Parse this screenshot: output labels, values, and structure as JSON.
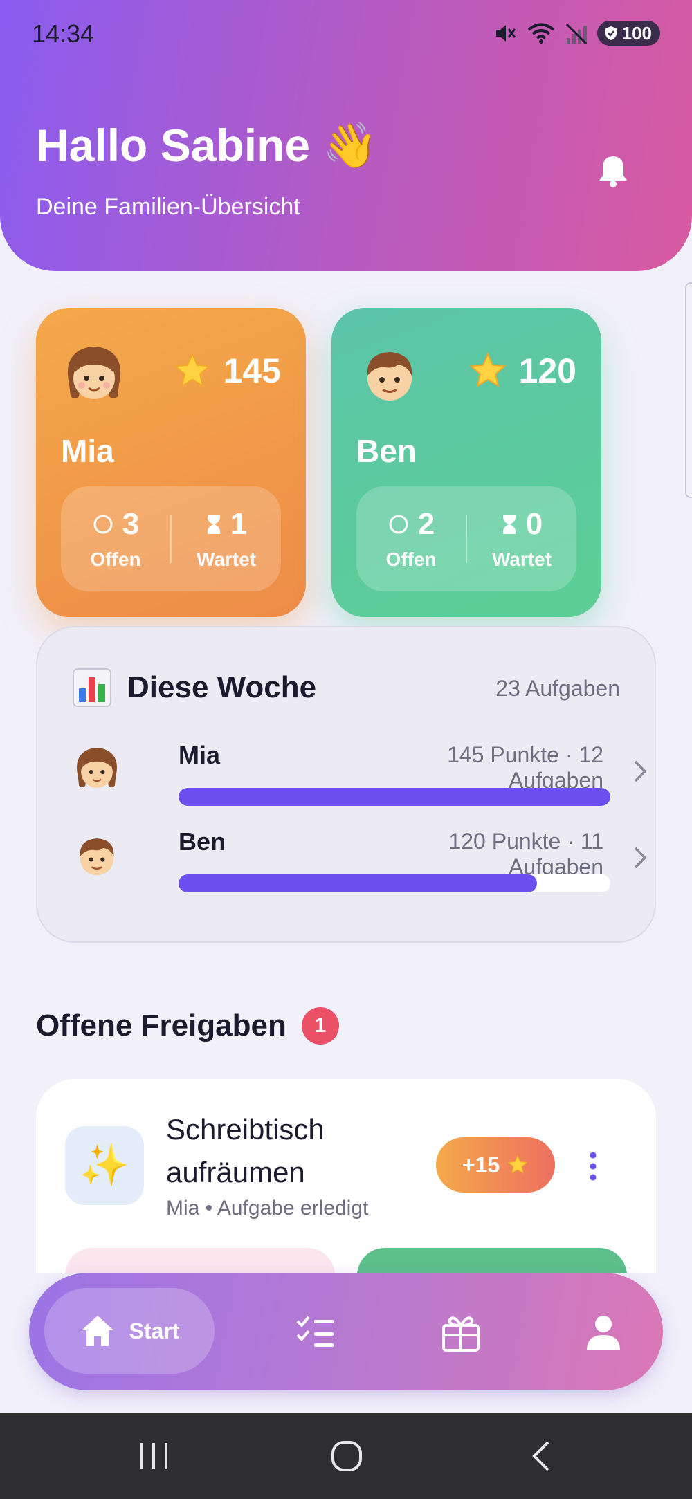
{
  "status_bar": {
    "time": "14:34",
    "battery": "100",
    "icons": [
      "mute-icon",
      "wifi-icon",
      "no-signal-icon",
      "battery-icon"
    ]
  },
  "header": {
    "greeting": "Hallo Sabine",
    "greeting_emoji": "👋",
    "subtitle": "Deine Familien-Übersicht",
    "icon": "bell-icon"
  },
  "colors": {
    "header_gradient": [
      "#8a5cf0",
      "#d85aa0"
    ],
    "mia_card": "#f4a94a",
    "ben_card": "#5dc4a8",
    "progress": "#6c4ff0",
    "badge": "#ec5067"
  },
  "kids": [
    {
      "name": "Mia",
      "avatar": "👧",
      "points": "145",
      "open_count": "3",
      "open_label": "Offen",
      "waiting_count": "1",
      "waiting_label": "Wartet"
    },
    {
      "name": "Ben",
      "avatar": "👦",
      "points": "120",
      "open_count": "2",
      "open_label": "Offen",
      "waiting_count": "0",
      "waiting_label": "Wartet"
    }
  ],
  "week": {
    "icon": "📊",
    "title": "Diese Woche",
    "total": "23 Aufgaben",
    "rows": [
      {
        "name": "Mia",
        "avatar": "👧",
        "meta": "145 Punkte · 12 Aufgaben",
        "progress": 1.0
      },
      {
        "name": "Ben",
        "avatar": "👦",
        "meta": "120 Punkte · 11 Aufgaben",
        "progress": 0.83
      }
    ]
  },
  "approvals": {
    "title": "Offene Freigaben",
    "badge_count": "1",
    "task": {
      "icon": "✨",
      "title": "Schreibtisch aufräumen",
      "subtitle": "Mia • Aufgabe erledigt",
      "reward": "+15",
      "reward_icon": "⭐"
    }
  },
  "bottom_nav": {
    "active_label": "Start",
    "items": [
      "home-icon",
      "tasks-icon",
      "gift-icon",
      "profile-icon"
    ]
  }
}
